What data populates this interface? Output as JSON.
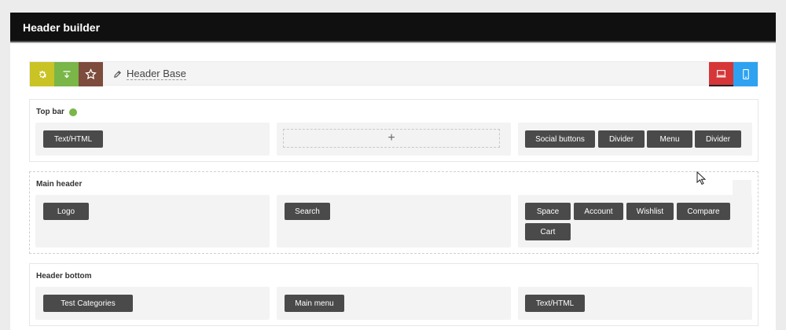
{
  "window": {
    "title": "Header builder"
  },
  "toolbar": {
    "base_name": "Header Base",
    "icons": [
      "gear-icon",
      "import-icon",
      "star-icon",
      "pencil-icon",
      "desktop-icon",
      "mobile-icon"
    ],
    "colors": {
      "gear": "#c9c325",
      "import": "#7ab648",
      "star": "#7d4c3c",
      "desktop": "#d63638",
      "mobile": "#2ea2f0"
    }
  },
  "sections": {
    "top_bar": {
      "title": "Top bar",
      "status_color": "#7ab648",
      "left": [
        "Text/HTML"
      ],
      "center_add": "+",
      "right": [
        "Social buttons",
        "Divider",
        "Menu",
        "Divider"
      ]
    },
    "main_header": {
      "title": "Main header",
      "left": [
        "Logo"
      ],
      "center": [
        "Search"
      ],
      "right": [
        "Space",
        "Account",
        "Wishlist",
        "Compare",
        "Cart"
      ]
    },
    "header_bottom": {
      "title": "Header bottom",
      "left": [
        "Test Categories"
      ],
      "center": [
        "Main menu"
      ],
      "right": [
        "Text/HTML"
      ]
    }
  }
}
